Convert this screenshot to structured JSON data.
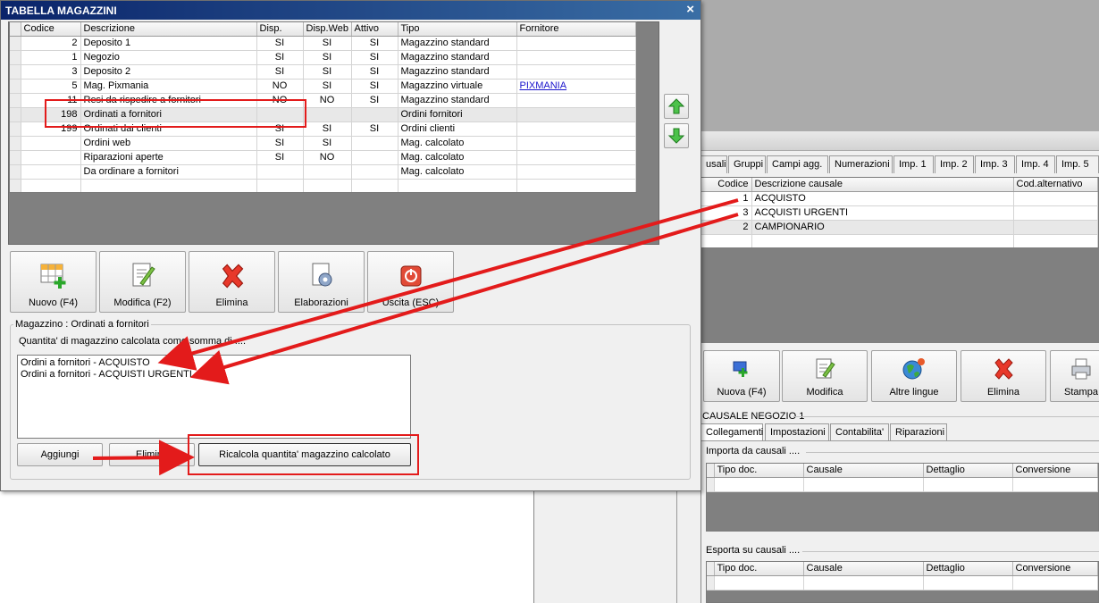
{
  "window": {
    "title": "TABELLA MAGAZZINI",
    "close_glyph": "×"
  },
  "warehouse_table": {
    "columns": [
      "Codice",
      "Descrizione",
      "Disp.",
      "Disp.Web",
      "Attivo",
      "Tipo",
      "Fornitore"
    ],
    "rows": [
      [
        "2",
        "Deposito 1",
        "SI",
        "SI",
        "SI",
        "Magazzino standard",
        ""
      ],
      [
        "1",
        "Negozio",
        "SI",
        "SI",
        "SI",
        "Magazzino standard",
        ""
      ],
      [
        "3",
        "Deposito 2",
        "SI",
        "SI",
        "SI",
        "Magazzino standard",
        ""
      ],
      [
        "5",
        "Mag. Pixmania",
        "NO",
        "SI",
        "SI",
        "Magazzino virtuale",
        "PIXMANIA"
      ],
      [
        "11",
        "Resi da rispedire a fornitori",
        "NO",
        "NO",
        "SI",
        "Magazzino standard",
        ""
      ],
      [
        "198",
        "Ordinati a fornitori",
        "",
        "",
        "",
        "Ordini fornitori",
        ""
      ],
      [
        "199",
        "Ordinati dai clienti",
        "SI",
        "SI",
        "SI",
        "Ordini clienti",
        ""
      ],
      [
        "",
        "Ordini web",
        "SI",
        "SI",
        "",
        "Mag. calcolato",
        ""
      ],
      [
        "",
        "Riparazioni aperte",
        "SI",
        "NO",
        "",
        "Mag. calcolato",
        ""
      ],
      [
        "",
        "Da ordinare a fornitori",
        "",
        "",
        "",
        "Mag. calcolato",
        ""
      ]
    ]
  },
  "toolbar": {
    "new_label": "Nuovo (F4)",
    "edit_label": "Modifica (F2)",
    "delete_label": "Elimina",
    "process_label": "Elaborazioni",
    "exit_label": "Uscita (ESC)"
  },
  "detail": {
    "group_title": "Magazzino : Ordinati a fornitori",
    "description": "Quantita' di magazzino calcolata come somma di ....",
    "list_items": [
      "Ordini a fornitori - ACQUISTO",
      "Ordini a fornitori - ACQUISTI URGENTI"
    ],
    "add_label": "Aggiungi",
    "remove_label": "Elimina",
    "recalc_label": "Ricalcola quantita' magazzino calcolato"
  },
  "right_panel": {
    "tabs": [
      "usali",
      "Gruppi",
      "Campi agg.",
      "Numerazioni",
      "Imp. 1",
      "Imp. 2",
      "Imp. 3",
      "Imp. 4",
      "Imp. 5"
    ],
    "causal_columns": [
      "Codice",
      "Descrizione causale",
      "Cod.alternativo"
    ],
    "causal_rows": [
      [
        "1",
        "ACQUISTO",
        ""
      ],
      [
        "3",
        "ACQUISTI URGENTI",
        ""
      ],
      [
        "2",
        "CAMPIONARIO",
        ""
      ]
    ],
    "toolbar": {
      "new_label": "Nuova (F4)",
      "edit_label": "Modifica",
      "lang_label": "Altre lingue",
      "delete_label": "Elimina",
      "print_label": "Stampa"
    },
    "section_title": "CAUSALE NEGOZIO 1",
    "sub_tabs": [
      "Collegamenti",
      "Impostazioni",
      "Contabilita'",
      "Riparazioni"
    ],
    "import_title": "Importa da causali ....",
    "export_title": "Esporta su causali ....",
    "link_columns": [
      "Tipo doc.",
      "Causale",
      "Dettaglio",
      "Conversione"
    ]
  },
  "colors": {
    "title_bar": "#0a246a",
    "accent_red": "#e31b1b",
    "link": "#1a14cc"
  }
}
